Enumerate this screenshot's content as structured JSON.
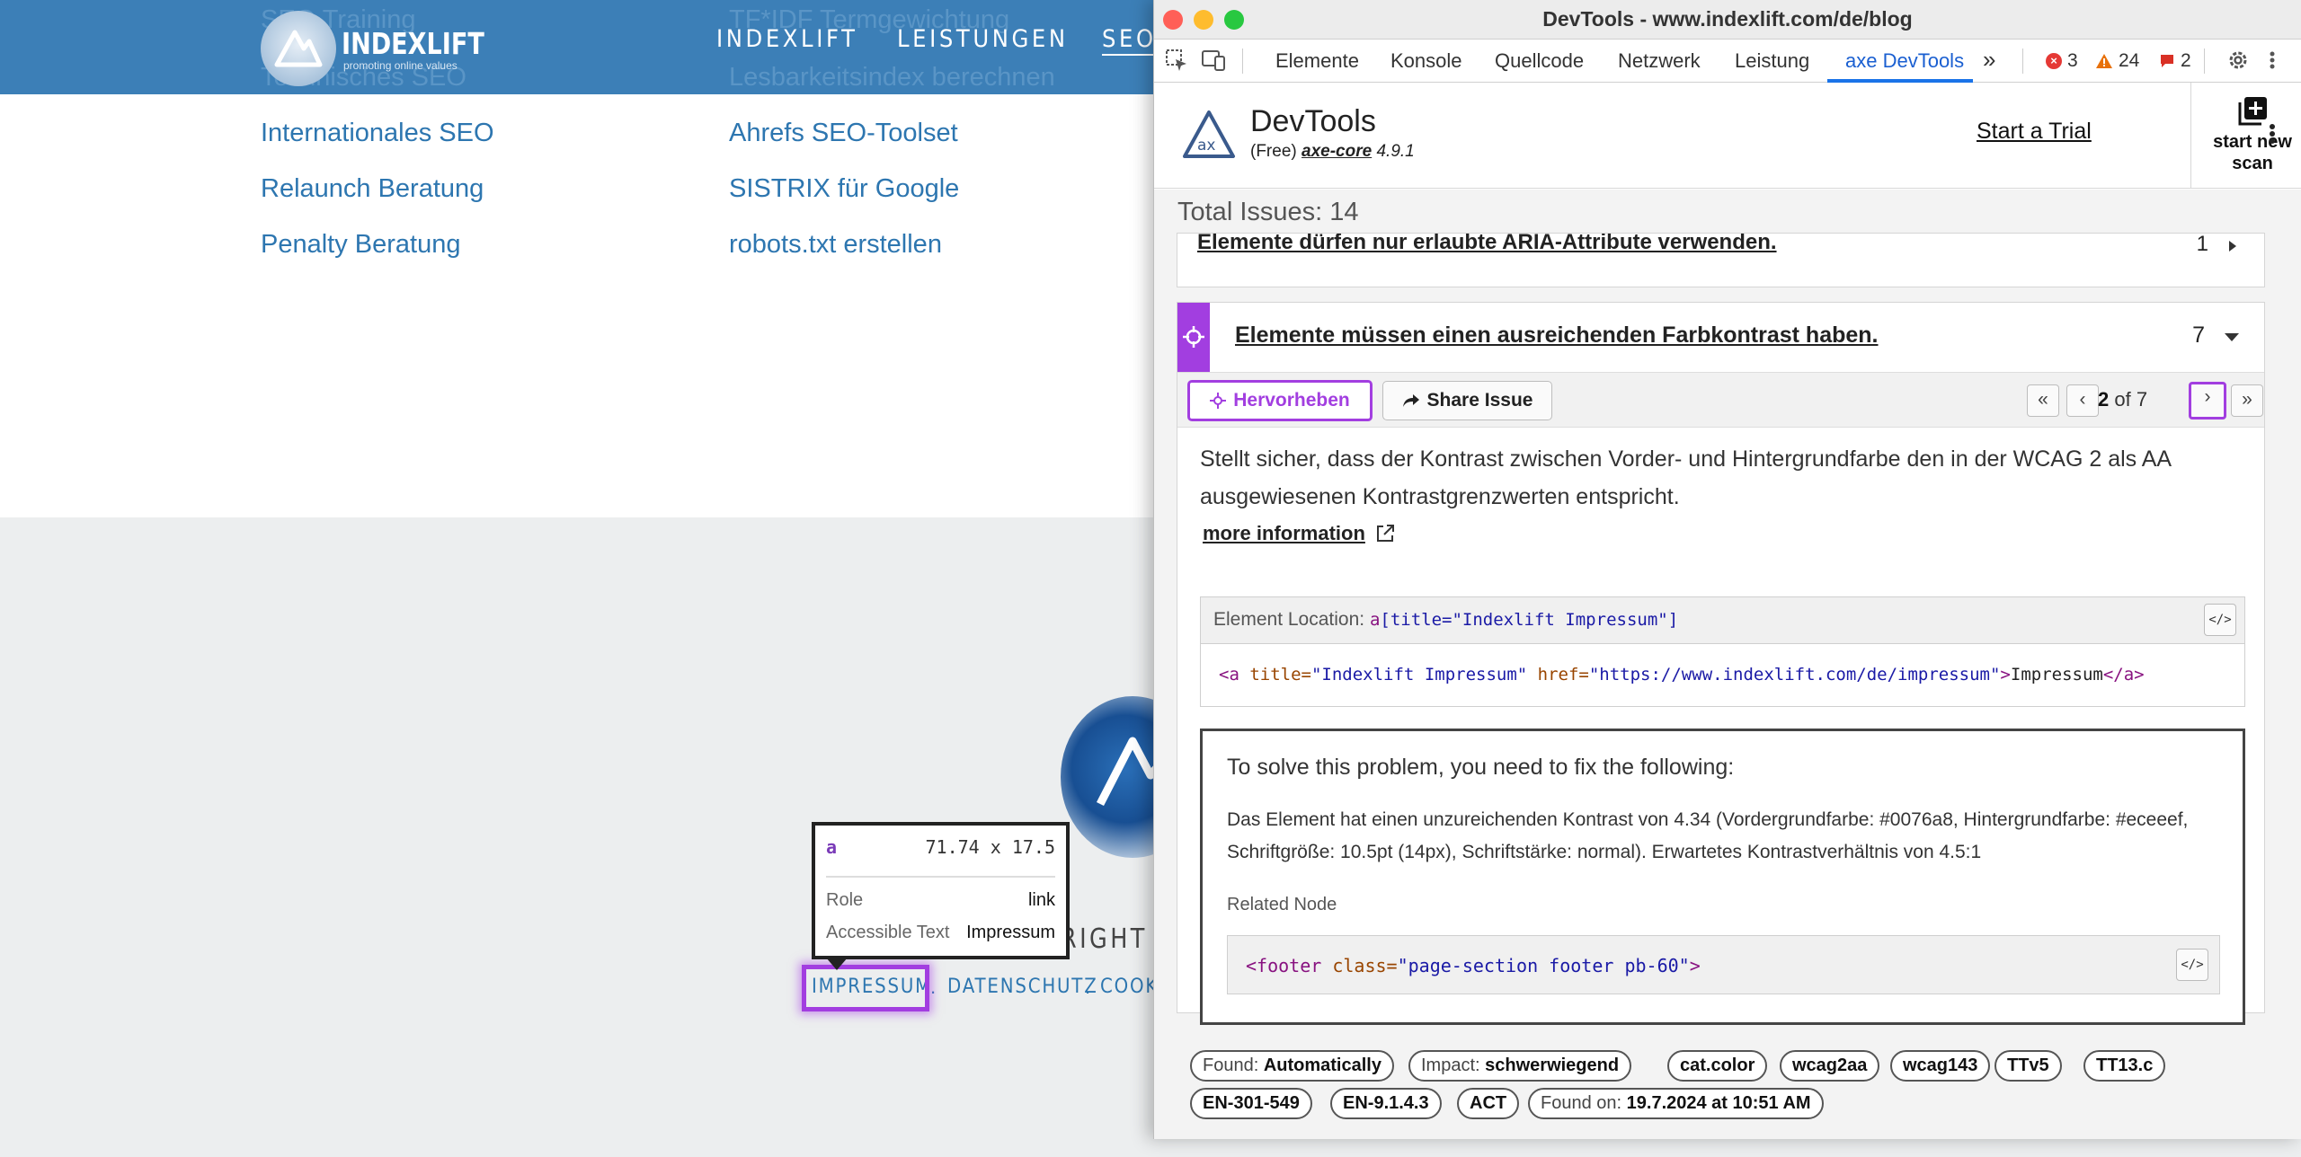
{
  "site": {
    "ghost_links": [
      "SEO Training",
      "Technisches SEO",
      "TF*IDF Termgewichtung",
      "Lesbarkeitsindex berechnen"
    ],
    "logo": {
      "name": "INDEXLIFT",
      "tagline": "promoting online values"
    },
    "nav": [
      "INDEXLIFT",
      "LEISTUNGEN",
      "SEO"
    ],
    "links_col1": [
      "Internationales SEO",
      "Relaunch Beratung",
      "Penalty Beratung"
    ],
    "links_col2": [
      "Ahrefs SEO-Toolset",
      "SISTRIX für Google",
      "robots.txt erstellen"
    ],
    "copyright_fragment": "RIGHT I",
    "footer_links": [
      "IMPRESSUM",
      "DATENSCHUTZ",
      "COOKI"
    ],
    "footer_sep": "."
  },
  "inspect_tooltip": {
    "tag": "a",
    "dimensions": "71.74 x 17.5",
    "role_label": "Role",
    "role_value": "link",
    "accessible_label": "Accessible Text",
    "accessible_value": "Impressum"
  },
  "devtools": {
    "window_title": "DevTools - www.indexlift.com/de/blog",
    "tabs": [
      "Elemente",
      "Konsole",
      "Quellcode",
      "Netzwerk",
      "Leistung",
      "axe DevTools"
    ],
    "active_tab": "axe DevTools",
    "overflow": "»",
    "errors": "3",
    "warnings": "24",
    "issues_badge": "2"
  },
  "axe": {
    "title": "DevTools",
    "plan": "(Free)",
    "core": "axe-core",
    "version": "4.9.1",
    "start_trial": "Start a Trial",
    "new_scan": "start new scan",
    "total_issues": "Total Issues: 14",
    "collapsed_issue": {
      "title": "Elemente dürfen nur erlaubte ARIA-Attribute verwenden.",
      "count": "1"
    },
    "issue": {
      "title": "Elemente müssen einen ausreichenden Farbkontrast haben.",
      "count": "7",
      "highlight_btn": "Hervorheben",
      "share_btn": "Share Issue",
      "pager_current": "2",
      "pager_of": "of 7",
      "description": "Stellt sicher, dass der Kontrast zwischen Vorder- und Hintergrundfarbe den in der WCAG 2 als AA ausgewiesenen Kontrastgrenzwerten entspricht.",
      "more_info": "more information",
      "location_label": "Element Location:",
      "location_selector_tag": "a",
      "location_selector_attr": "[title=\"Indexlift Impressum\"]",
      "code_tag_open": "<a",
      "code_attr_title": "title=",
      "code_title_val": "\"Indexlift Impressum\"",
      "code_attr_href": "href=",
      "code_href_val": "\"https://www.indexlift.com/de/impressum\"",
      "code_text": "Impressum",
      "code_tag_close": "</a>",
      "fix_title": "To solve this problem, you need to fix the following:",
      "fix_message": "Das Element hat einen unzureichenden Kontrast von 4.34 (Vordergrundfarbe: #0076a8, Hintergrundfarbe: #eceeef, Schriftgröße: 10.5pt (14px), Schriftstärke: normal). Erwartetes Kontrastverhältnis von 4.5:1",
      "related_label": "Related Node",
      "related_tag": "<footer",
      "related_attr": "class=",
      "related_val": "\"page-section footer pb-60\"",
      "related_close": ">"
    },
    "tags": {
      "found_k": "Found:",
      "found_v": "Automatically",
      "impact_k": "Impact:",
      "impact_v": "schwerwiegend",
      "list1": [
        "cat.color",
        "wcag2aa",
        "wcag143",
        "TTv5",
        "TT13.c"
      ],
      "list2": [
        "EN-301-549",
        "EN-9.1.4.3",
        "ACT"
      ],
      "found_on_k": "Found on:",
      "found_on_v": "19.7.2024 at 10:51 AM"
    }
  },
  "colors": {
    "accent": "#a23ee0",
    "site_blue": "#3c7fb7",
    "link_blue": "#2d76b0",
    "footer_bg": "#eceeef"
  }
}
